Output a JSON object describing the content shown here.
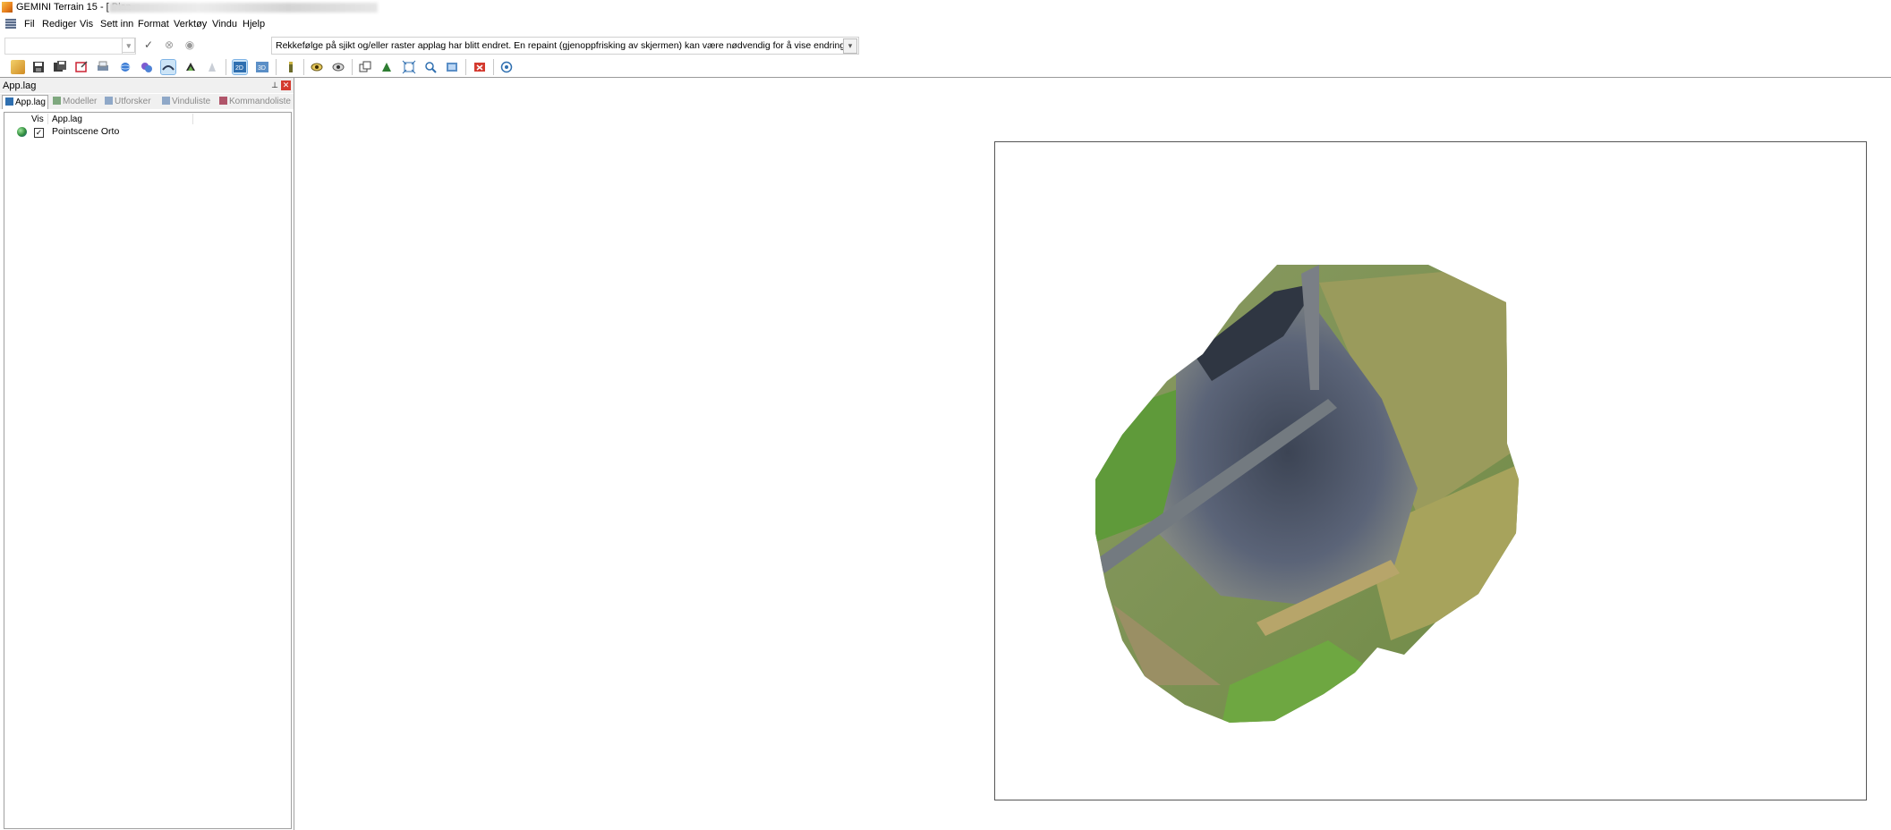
{
  "window": {
    "title": "GEMINI Terrain 15 - [  Plan",
    "title_redacted": true
  },
  "menu": [
    "Fil",
    "Rediger",
    "Vis",
    "Sett inn",
    "Format",
    "Verktøy",
    "Vindu",
    "Hjelp"
  ],
  "toolbar1": {
    "combo_value": "",
    "buttons": [
      "dropdown-icon",
      "check-icon",
      "cancel-icon",
      "clear-icon"
    ],
    "message": "Rekkefølge på sjikt og/eller raster applag har blitt endret. En repaint (gjenoppfrisking av skjermen) kan være nødvendig for å vise endringer."
  },
  "toolbar2": {
    "icons": [
      "open-icon",
      "save-icon",
      "save-all-icon",
      "export-icon",
      "print-icon",
      "globe-icon",
      "layers-icon",
      "terrain-icon",
      "model-icon",
      "wizard-icon",
      "2d-view-icon",
      "3d-view-icon",
      "marker-icon",
      "eye-icon",
      "eye-settings-icon",
      "copy-icon",
      "tree-icon",
      "zoom-extent-icon",
      "zoom-icon",
      "fullscreen-icon",
      "cancel-red-icon",
      "web-icon"
    ],
    "active": [
      "terrain-icon",
      "2d-view-icon"
    ]
  },
  "panel": {
    "title": "App.lag",
    "tabs": [
      {
        "label": "App.lag",
        "active": true
      },
      {
        "label": "Modeller",
        "active": false
      },
      {
        "label": "Utforsker",
        "active": false
      },
      {
        "label": "Vinduliste",
        "active": false
      },
      {
        "label": "Kommandoliste",
        "active": false
      }
    ],
    "columns": [
      "Vis",
      "App.lag"
    ],
    "layers": [
      {
        "name": "Pointscene Orto",
        "visible": true,
        "icon": "globe-icon"
      }
    ]
  },
  "colors": {
    "active_highlight": "#cce4f7",
    "close_button": "#d43a2f",
    "frame_border": "#555555"
  }
}
